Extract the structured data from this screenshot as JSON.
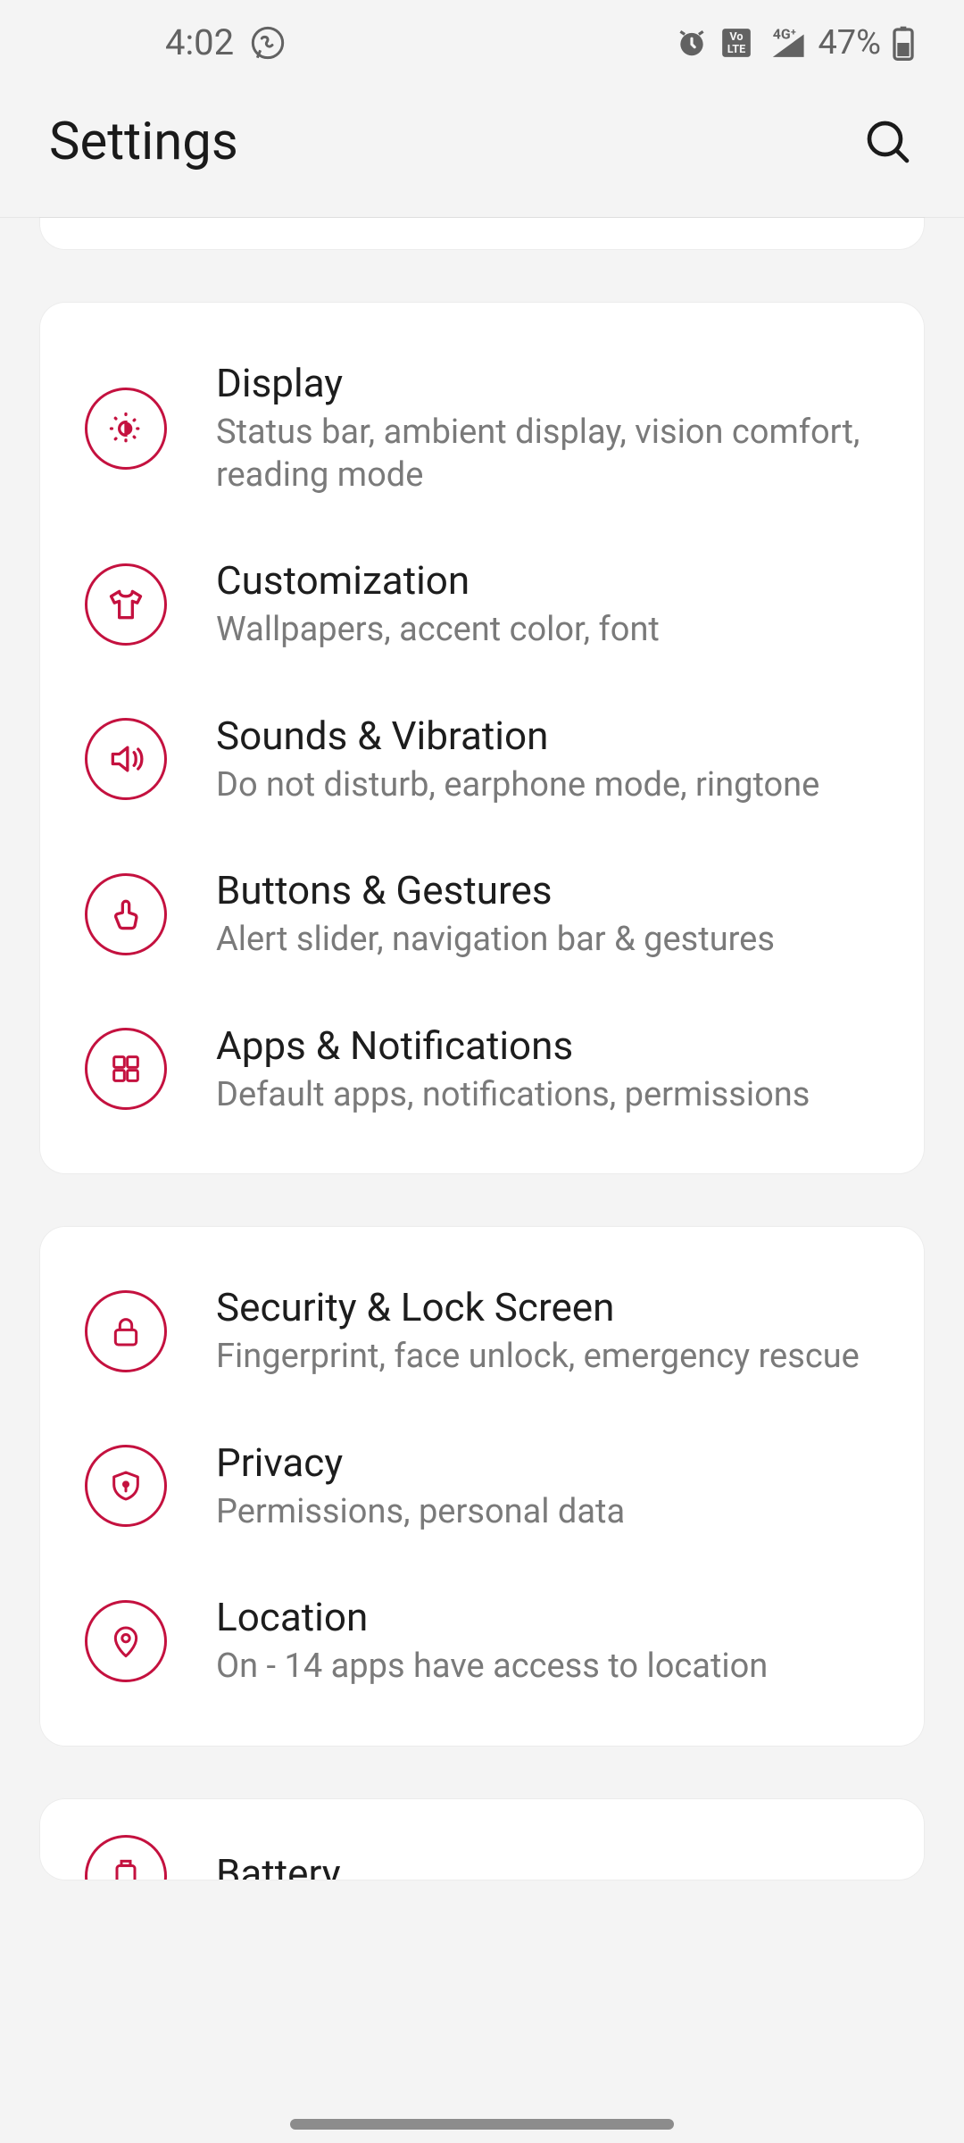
{
  "status": {
    "time": "4:02",
    "battery": "47%"
  },
  "header": {
    "title": "Settings"
  },
  "groups": [
    {
      "items": [
        {
          "icon": "brightness",
          "title": "Display",
          "subtitle": "Status bar, ambient display, vision comfort, reading mode"
        },
        {
          "icon": "shirt",
          "title": "Customization",
          "subtitle": "Wallpapers, accent color, font"
        },
        {
          "icon": "speaker",
          "title": "Sounds & Vibration",
          "subtitle": "Do not disturb, earphone mode, ringtone"
        },
        {
          "icon": "touch",
          "title": "Buttons & Gestures",
          "subtitle": "Alert slider, navigation bar & gestures"
        },
        {
          "icon": "grid",
          "title": "Apps & Notifications",
          "subtitle": "Default apps, notifications, permissions"
        }
      ]
    },
    {
      "items": [
        {
          "icon": "lock",
          "title": "Security & Lock Screen",
          "subtitle": "Fingerprint, face unlock, emergency rescue"
        },
        {
          "icon": "shield",
          "title": "Privacy",
          "subtitle": "Permissions, personal data"
        },
        {
          "icon": "pin",
          "title": "Location",
          "subtitle": "On - 14 apps have access to location"
        }
      ]
    },
    {
      "items": [
        {
          "icon": "battery",
          "title": "Battery",
          "subtitle": ""
        }
      ]
    }
  ],
  "accent": "#c4113f"
}
